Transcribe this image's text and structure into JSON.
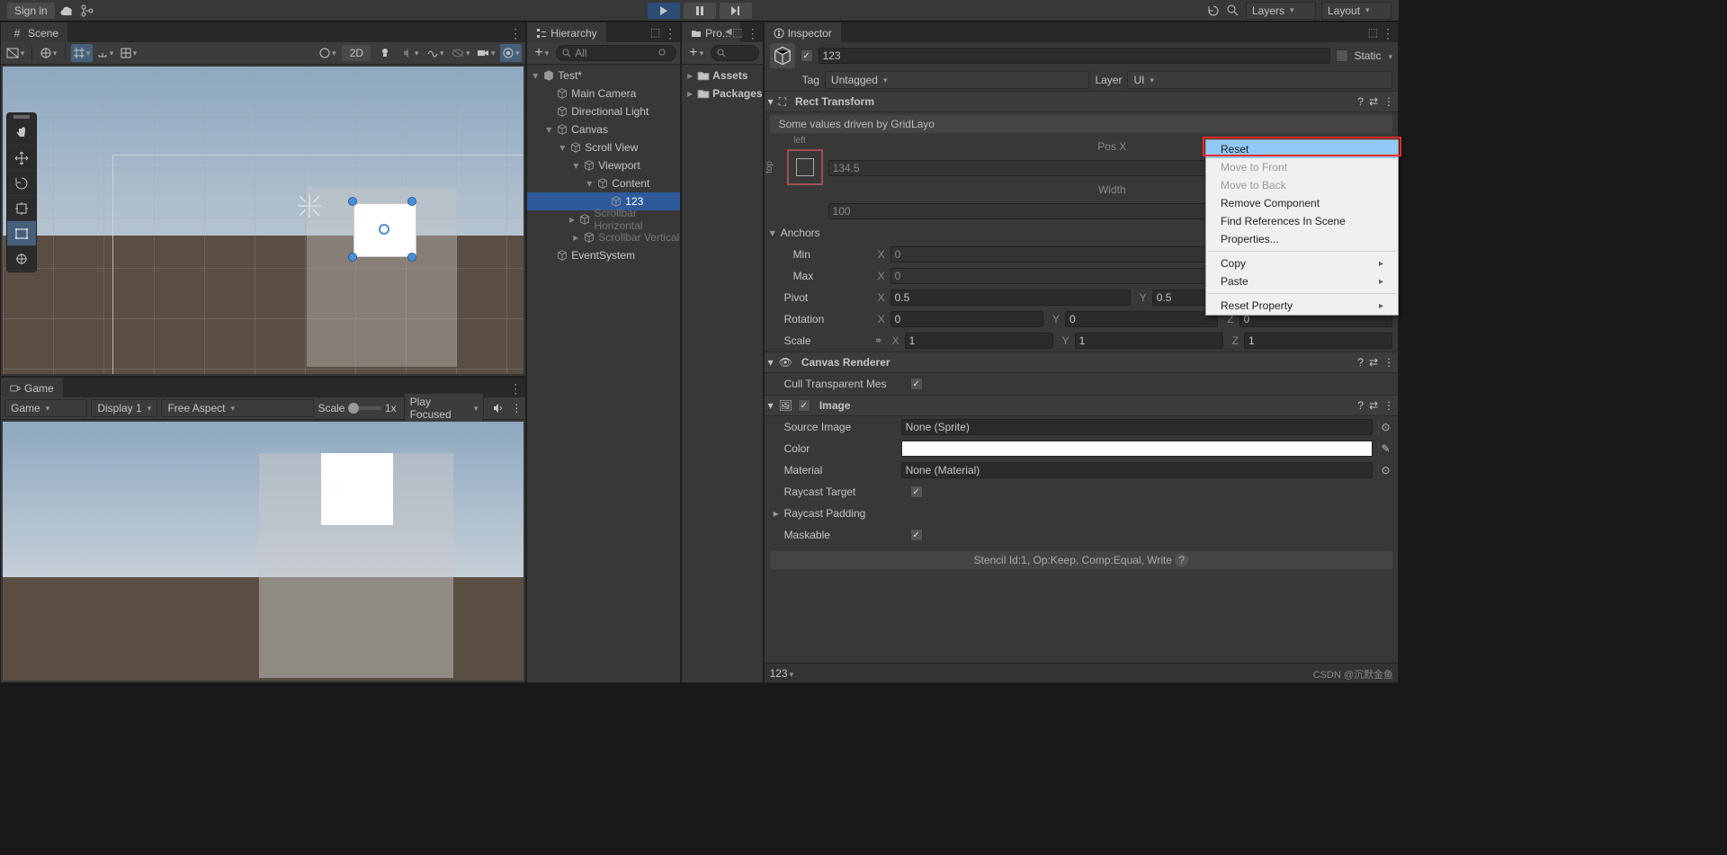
{
  "topbar": {
    "signIn": "Sign in",
    "layers": "Layers",
    "layout": "Layout"
  },
  "scene": {
    "tabLabel": "Scene",
    "btn2D": "2D"
  },
  "game": {
    "tabLabel": "Game",
    "device": "Game",
    "display": "Display 1",
    "aspect": "Free Aspect",
    "scaleLabel": "Scale",
    "scaleVal": "1x",
    "playMode": "Play Focused"
  },
  "hierarchy": {
    "tabLabel": "Hierarchy",
    "searchPlaceholder": "All",
    "items": [
      {
        "label": "Test*",
        "depth": 0,
        "expand": "▾",
        "scene": true
      },
      {
        "label": "Main Camera",
        "depth": 1,
        "expand": ""
      },
      {
        "label": "Directional Light",
        "depth": 1,
        "expand": ""
      },
      {
        "label": "Canvas",
        "depth": 1,
        "expand": "▾"
      },
      {
        "label": "Scroll View",
        "depth": 2,
        "expand": "▾"
      },
      {
        "label": "Viewport",
        "depth": 3,
        "expand": "▾"
      },
      {
        "label": "Content",
        "depth": 4,
        "expand": "▾"
      },
      {
        "label": "123",
        "depth": 5,
        "expand": "",
        "sel": true
      },
      {
        "label": "Scrollbar Horizontal",
        "depth": 3,
        "expand": "▸",
        "dim": true
      },
      {
        "label": "Scrollbar Vertical",
        "depth": 3,
        "expand": "▸",
        "dim": true
      },
      {
        "label": "EventSystem",
        "depth": 1,
        "expand": ""
      }
    ]
  },
  "project": {
    "tabLabel": "Pro...",
    "folders": [
      "Assets",
      "Packages"
    ]
  },
  "inspector": {
    "tabLabel": "Inspector",
    "objName": "123",
    "static": "Static",
    "tagLabel": "Tag",
    "tagVal": "Untagged",
    "layerLabel": "Layer",
    "layerVal": "UI",
    "rect": {
      "title": "Rect Transform",
      "driven": "Some values driven by GridLayo",
      "anchorH": "left",
      "anchorV": "top",
      "posXLabel": "Pos X",
      "posX": "134.5",
      "widthLabel": "Width",
      "width": "100",
      "anchors": "Anchors",
      "minLabel": "Min",
      "minX": "0",
      "maxLabel": "Max",
      "maxX": "0",
      "pivotLabel": "Pivot",
      "pivotX": "0.5",
      "pivotY": "0.5",
      "rotLabel": "Rotation",
      "rotX": "0",
      "rotY": "0",
      "rotZ": "0",
      "scaleLabel": "Scale",
      "scaleX": "1",
      "scaleY": "1",
      "scaleZ": "1"
    },
    "canvasRenderer": {
      "title": "Canvas Renderer",
      "cull": "Cull Transparent Mes"
    },
    "image": {
      "title": "Image",
      "source": "Source Image",
      "sourceVal": "None (Sprite)",
      "color": "Color",
      "material": "Material",
      "materialVal": "None (Material)",
      "raycast": "Raycast Target",
      "padding": "Raycast Padding",
      "maskable": "Maskable"
    },
    "stencil": "Stencil Id:1, Op:Keep, Comp:Equal, Write",
    "previewLabel": "123"
  },
  "contextMenu": {
    "items": [
      {
        "label": "Reset",
        "hover": true
      },
      {
        "label": "Move to Front",
        "dis": true
      },
      {
        "label": "Move to Back",
        "dis": true
      },
      {
        "label": "Remove Component"
      },
      {
        "label": "Find References In Scene"
      },
      {
        "label": "Properties..."
      },
      {
        "sep": true
      },
      {
        "label": "Copy",
        "sub": true
      },
      {
        "label": "Paste",
        "sub": true
      },
      {
        "sep": true
      },
      {
        "label": "Reset Property",
        "sub": true
      }
    ]
  },
  "watermark": "CSDN @沉默金鱼"
}
